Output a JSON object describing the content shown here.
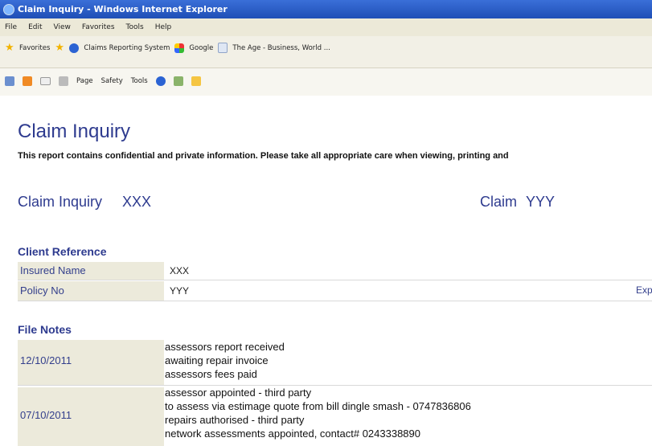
{
  "window": {
    "title": "Claim Inquiry - Windows Internet Explorer"
  },
  "menu": [
    "File",
    "Edit",
    "View",
    "Favorites",
    "Tools",
    "Help"
  ],
  "favorites": {
    "label": "Favorites",
    "links": [
      "Claims Reporting System",
      "Google",
      "The Age - Business, World ..."
    ]
  },
  "commandbar": {
    "page": "Page",
    "safety": "Safety",
    "tools": "Tools"
  },
  "report": {
    "title": "Claim Inquiry",
    "notice": "This report contains confidential and private information. Please take all appropriate care when viewing, printing and",
    "claim_inquiry_label": "Claim Inquiry",
    "claim_inquiry_value": "XXX",
    "claim_label": "Claim",
    "claim_value": "YYY"
  },
  "client_reference": {
    "heading": "Client Reference",
    "rows": [
      {
        "label": "Insured Name",
        "value": "XXX"
      },
      {
        "label": "Policy No",
        "value": "YYY",
        "extra": "Expir"
      }
    ]
  },
  "file_notes": {
    "heading": "File Notes",
    "entries": [
      {
        "date": "12/10/2011",
        "lines": [
          "assessors report received",
          "awaiting repair invoice",
          "assessors fees paid"
        ]
      },
      {
        "date": "07/10/2011",
        "lines": [
          "assessor appointed - third party",
          "to assess via estimage quote from bill dingle smash - 0747836806",
          "repairs authorised - third party",
          "network assessments appointed, contact# 0243338890"
        ]
      }
    ]
  }
}
